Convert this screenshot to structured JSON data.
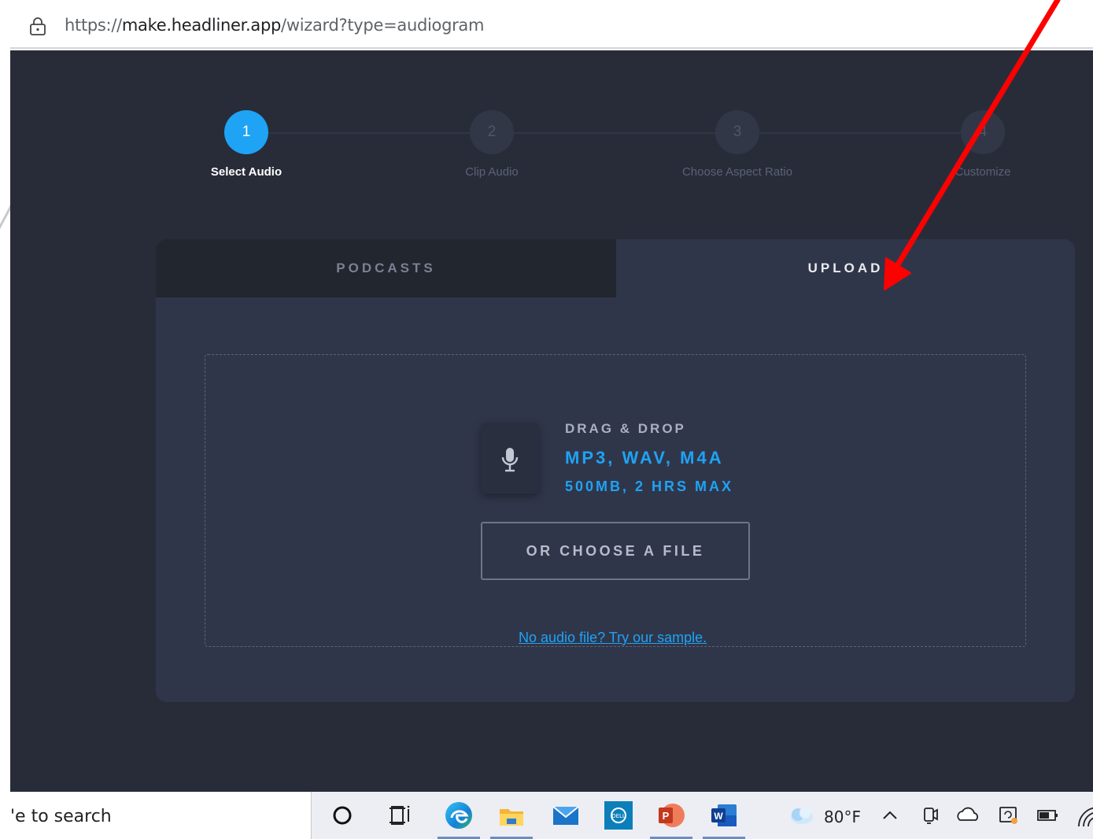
{
  "browser": {
    "url_prefix": "https://",
    "url_host": "make.headliner.app",
    "url_path": "/wizard?type=audiogram"
  },
  "wizard": {
    "steps": [
      {
        "number": "1",
        "label": "Select Audio",
        "active": true
      },
      {
        "number": "2",
        "label": "Clip Audio",
        "active": false
      },
      {
        "number": "3",
        "label": "Choose Aspect Ratio",
        "active": false
      },
      {
        "number": "4",
        "label": "Customize",
        "active": false
      }
    ]
  },
  "tabs": {
    "podcasts": "PODCASTS",
    "upload": "UPLOAD",
    "selected": "UPLOAD"
  },
  "dropzone": {
    "title": "DRAG & DROP",
    "formats": "MP3, WAV, M4A",
    "limits": "500MB, 2 HRS MAX",
    "choose_button": "OR CHOOSE A FILE",
    "sample_link": "No audio file? Try our sample."
  },
  "taskbar": {
    "search_text": "'e to search",
    "weather_temp": "80°F"
  },
  "icons": {
    "lock": "lock-icon",
    "mic": "microphone-icon",
    "cortana": "cortana-icon",
    "task_view": "task-view-icon",
    "edge": "edge-icon",
    "explorer": "file-explorer-icon",
    "mail": "mail-icon",
    "dell": "dell-icon",
    "powerpoint": "powerpoint-icon",
    "word": "word-icon",
    "weather": "weather-icon"
  },
  "colors": {
    "accent": "#1ea3f5",
    "app_bg": "#282c39",
    "card_bg": "#30364a",
    "annotation_arrow": "#ff0000"
  }
}
